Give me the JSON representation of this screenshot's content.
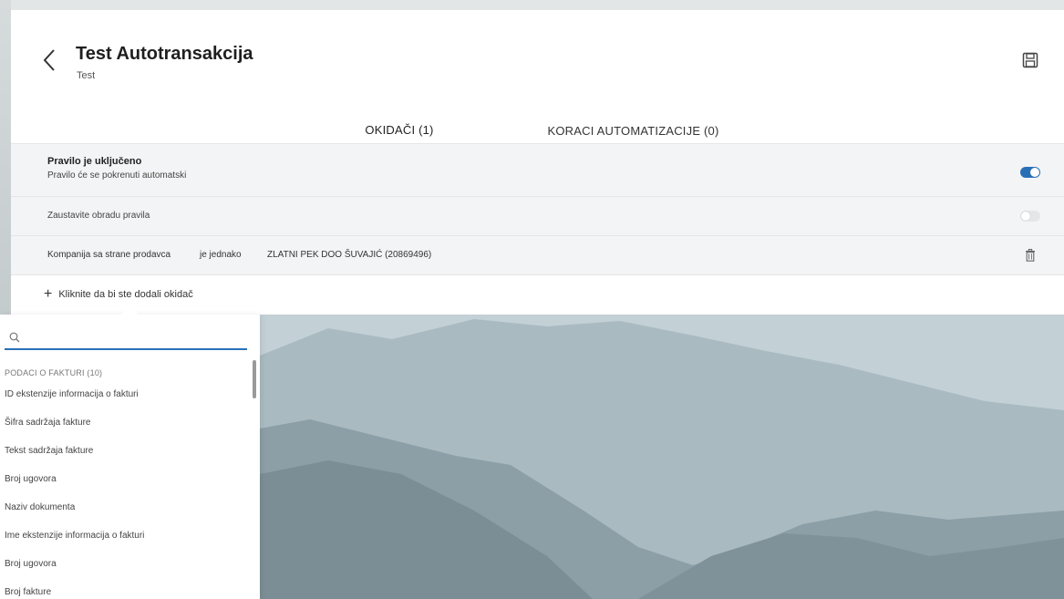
{
  "header": {
    "title": "Test Autotransakcija",
    "subtitle": "Test",
    "back_icon": "chevron-left-icon",
    "save_icon": "save-icon"
  },
  "tabs": [
    {
      "label": "OKIDAČI (1)",
      "active": true
    },
    {
      "label": "KORACI AUTOMATIZACIJE (0)",
      "active": false
    }
  ],
  "rules": {
    "enabled": {
      "title": "Pravilo je uključeno",
      "description": "Pravilo će se pokrenuti automatski",
      "toggle_on": true
    },
    "stop_processing": {
      "label": "Zaustavite obradu pravila",
      "toggle_on": false
    },
    "condition": {
      "field": "Kompanija sa strane prodavca",
      "operator": "je jednako",
      "value": "ZLATNI PEK DOO ŠUVAJIĆ (20869496)",
      "delete_icon": "trash-icon"
    },
    "add_trigger_label": "Kliknite da bi ste dodali okidač"
  },
  "dropdown": {
    "search_value": "",
    "group_header": "PODACI O FAKTURI (10)",
    "items": [
      "ID ekstenzije informacija o fakturi",
      "Šifra sadržaja fakture",
      "Tekst sadržaja fakture",
      "Broj ugovora",
      "Naziv dokumenta",
      "Ime ekstenzije informacija o fakturi",
      "Broj ugovora",
      "Broj fakture"
    ]
  },
  "colors": {
    "accent": "#2a6fb6",
    "row_background": "#f3f4f5"
  }
}
